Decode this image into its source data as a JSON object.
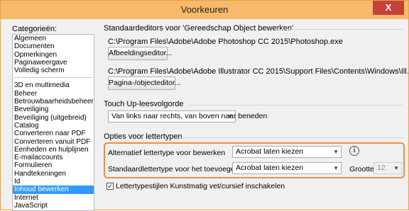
{
  "window": {
    "title": "Voorkeuren",
    "close_label": "X"
  },
  "categories": {
    "label": "Categorieën:",
    "group1": [
      "Algemeen",
      "Documenten",
      "Opmerkingen",
      "Paginaweergave",
      "Volledig scherm"
    ],
    "group2": [
      "3D en multimedia",
      "Beheer",
      "Betrouwbaarheidsbeheer",
      "Beveiliging",
      "Beveiliging (uitgebreid)",
      "Catalog",
      "Converteren naar PDF",
      "Converteren vanuit PDF",
      "Eenheden en hulplijnen",
      "E-mailaccounts",
      "Formulieren",
      "Handtekeningen",
      "Id",
      "Inhoud bewerken",
      "Internet",
      "JavaScript"
    ],
    "selected": "Inhoud bewerken"
  },
  "editors": {
    "title": "Standaardeditors voor 'Gereedschap Object bewerken'",
    "image_path": "C:\\Program Files\\Adobe\\Adobe Photoshop CC 2015\\Photoshop.exe",
    "image_button": "Afbeeldingseditor...",
    "page_path": "C:\\Program Files\\Adobe\\Adobe Illustrator CC 2015\\Support Files\\Contents\\Windows\\Ill...",
    "page_button": "Pagina-/objecteditor..."
  },
  "touchup": {
    "title": "Touch Up-leesvolgorde",
    "order_value": "Van links naar rechts, van boven naar beneden"
  },
  "fonts": {
    "title": "Opties voor lettertypen",
    "alt_label": "Alternatief lettertype voor bewerken",
    "alt_value": "Acrobat laten kiezen",
    "std_label": "Standaardlettertype voor het toevoegen van tekst",
    "std_value": "Acrobat laten kiezen",
    "size_label": "Grootte",
    "size_value": "12",
    "styles_label": "Lettertypestijlen Kunstmatig vet/cursief inschakelen",
    "styles_checked": true,
    "info_icon": "info-icon",
    "highlight_color": "#e8904a"
  }
}
